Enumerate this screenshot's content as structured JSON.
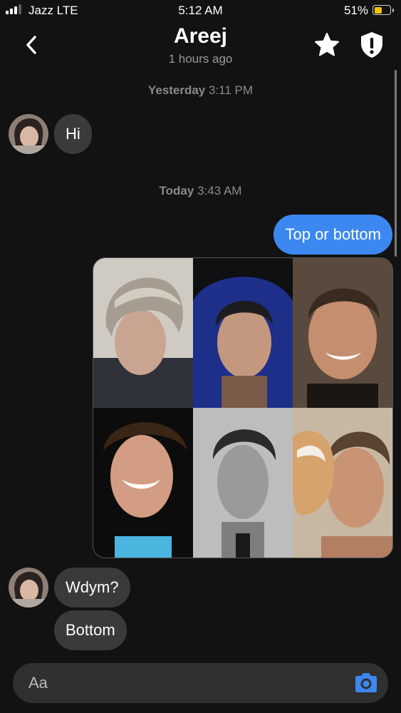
{
  "status_bar": {
    "carrier": "Jazz LTE",
    "time": "5:12 AM",
    "battery_percent": "51%",
    "battery_level": 0.51,
    "signal_bars": 3
  },
  "header": {
    "title": "Areej",
    "subtitle": "1 hours ago"
  },
  "icons": {
    "back": "chevron-left-icon",
    "favorite": "star-icon",
    "safety": "shield-exclamation-icon",
    "camera": "camera-icon"
  },
  "colors": {
    "background": "#121212",
    "sent_bubble": "#3d88f0",
    "received_bubble": "#3a3a3c",
    "camera_icon": "#3d88f0"
  },
  "messages": {
    "timestamp1": {
      "day": "Yesterday",
      "time": "3:11 PM"
    },
    "msg1": "Hi",
    "timestamp2": {
      "day": "Today",
      "time": "3:43 AM"
    },
    "msg2": "Top or bottom",
    "msg3": "Wdym?",
    "msg4": "Bottom"
  },
  "composer": {
    "placeholder": "Aa"
  }
}
